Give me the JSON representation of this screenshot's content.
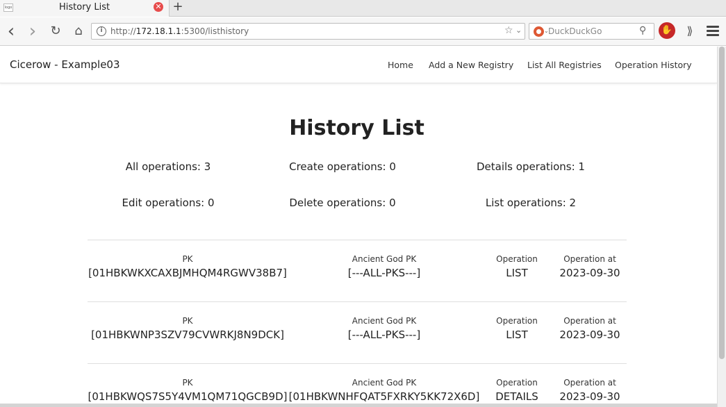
{
  "browser": {
    "tab_title": "History List",
    "favicon_text": "logo",
    "close_glyph": "✕",
    "new_tab_glyph": "+",
    "url_prefix": "http://",
    "url_host": "172.18.1.1",
    "url_rest": ":5300/listhistory",
    "search_placeholder": "DuckDuckGo",
    "icons": {
      "back": "‹",
      "forward": "›",
      "reload": "↻",
      "home": "⌂",
      "info": "i",
      "bookmark": "☆",
      "dropdown": "⌄",
      "search": "⚲",
      "ublock": "✋",
      "overflow": "⟫"
    }
  },
  "site": {
    "brand": "Cicerow - Example03",
    "nav": [
      "Home",
      "Add a New Registry",
      "List All Registries",
      "Operation History"
    ]
  },
  "main": {
    "title": "History List",
    "stats": {
      "all": "All operations: 3",
      "create": "Create operations: 0",
      "details": "Details operations: 1",
      "edit": "Edit operations: 0",
      "delete": "Delete operations: 0",
      "list": "List operations: 2"
    },
    "labels": {
      "pk": "PK",
      "ancient_god_pk": "Ancient God PK",
      "operation": "Operation",
      "operation_at": "Operation at"
    },
    "rows": [
      {
        "pk": "[01HBKWKXCAXBJMHQM4RGWV38B7]",
        "ancient_god_pk": "[---ALL-PKS---]",
        "operation": "LIST",
        "operation_at": "2023-09-30"
      },
      {
        "pk": "[01HBKWNP3SZV79CVWRKJ8N9DCK]",
        "ancient_god_pk": "[---ALL-PKS---]",
        "operation": "LIST",
        "operation_at": "2023-09-30"
      },
      {
        "pk": "[01HBKWQS7S5Y4VM1QM71QGCB9D]",
        "ancient_god_pk": "[01HBKWNHFQAT5FXRKY5KK72X6D]",
        "operation": "DETAILS",
        "operation_at": "2023-09-30"
      }
    ]
  },
  "colors": {
    "close_button": "#e74c4c",
    "ublock": "#c62828",
    "duckduckgo": "#de5833"
  }
}
